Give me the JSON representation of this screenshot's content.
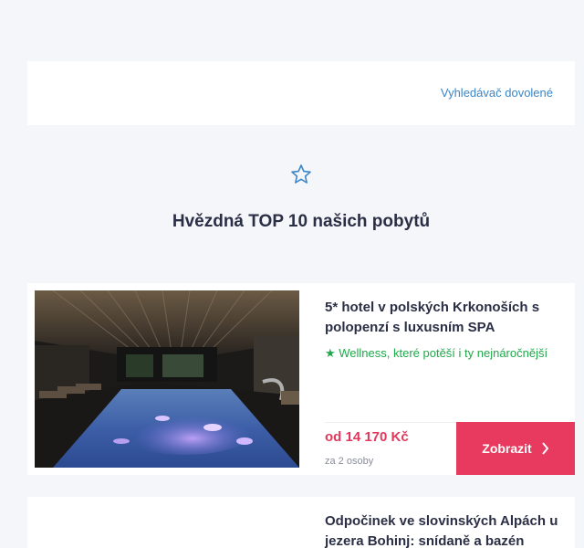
{
  "header": {
    "link_label": "Vyhledávač dovolené"
  },
  "section": {
    "icon": "star-outline-icon",
    "title": "Hvězdná TOP 10 našich pobytů"
  },
  "colors": {
    "accent": "#e8395e",
    "link": "#3a86c8",
    "feature": "#1fa84a",
    "price": "#e0395c"
  },
  "offers": [
    {
      "title": "5* hotel v polských Krkonoších s polopenzí s luxusním SPA",
      "feature": "★ Wellness, které potěší i ty nejnáročnější",
      "price": "od 14 170 Kč",
      "persons": "za 2 osoby",
      "button_label": "Zobrazit"
    },
    {
      "title": "Odpočinek ve slovinských Alpách u jezera Bohinj: snídaně a bazén"
    }
  ]
}
